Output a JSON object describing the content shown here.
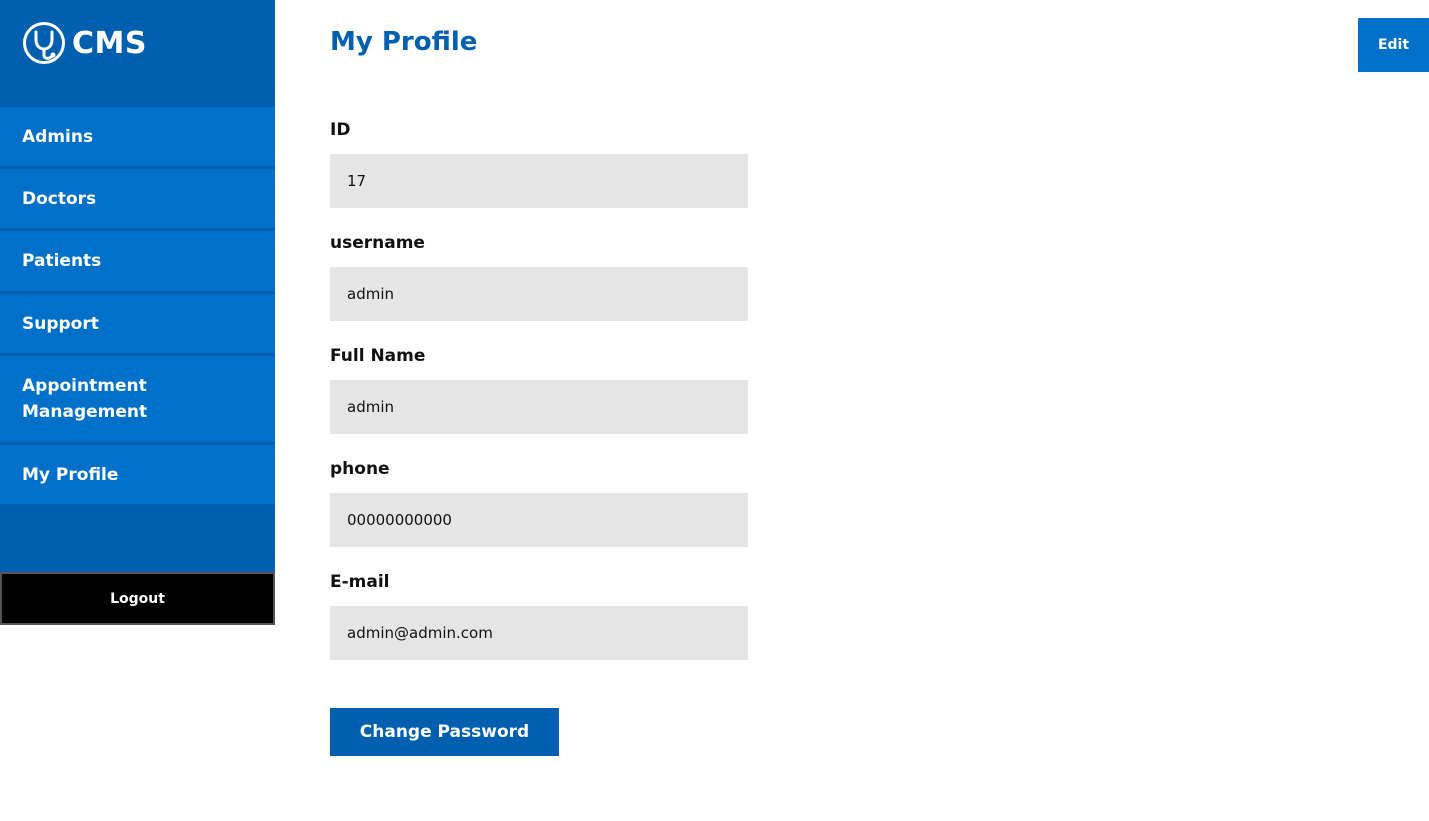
{
  "brand": {
    "icon": "stethoscope-icon",
    "name": "CMS"
  },
  "sidebar": {
    "items": [
      {
        "label": "Admins"
      },
      {
        "label": "Doctors"
      },
      {
        "label": "Patients"
      },
      {
        "label": "Support"
      },
      {
        "label": "Appointment Management"
      },
      {
        "label": "My Profile"
      }
    ],
    "logout_label": "Logout"
  },
  "main": {
    "title": "My Profile",
    "edit_label": "Edit",
    "fields": [
      {
        "label": "ID",
        "value": "17"
      },
      {
        "label": "username",
        "value": "admin"
      },
      {
        "label": "Full Name",
        "value": "admin"
      },
      {
        "label": "phone",
        "value": "00000000000"
      },
      {
        "label": "E-mail",
        "value": "admin@admin.com"
      }
    ],
    "change_password_label": "Change Password"
  },
  "colors": {
    "sidebar": "#005fae",
    "nav_item": "#0070c9",
    "logout": "#000000",
    "title": "#005fae",
    "input_bg": "#e5e5e5"
  }
}
